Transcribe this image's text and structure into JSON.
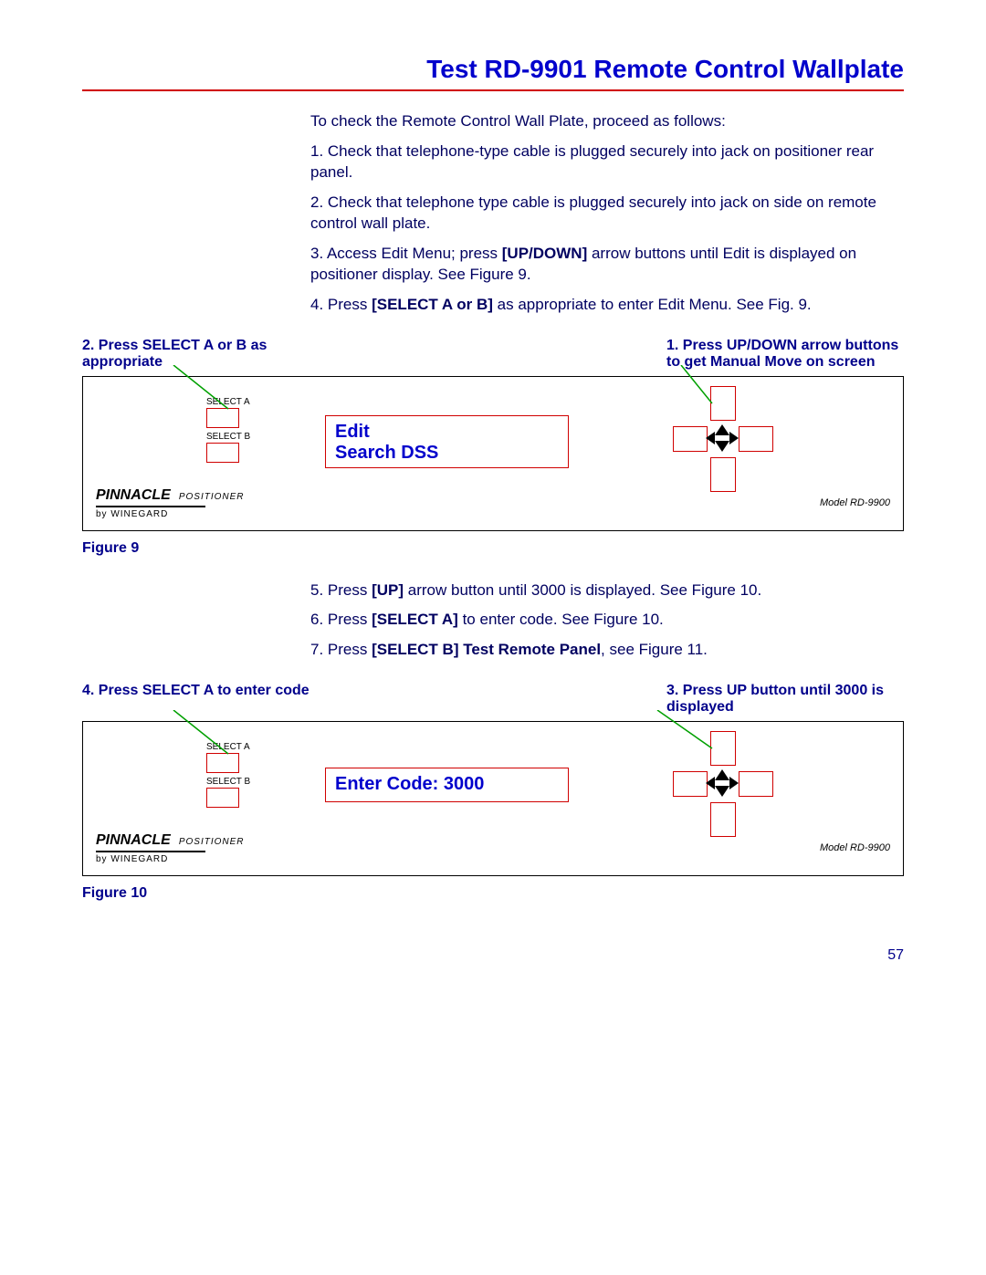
{
  "title": "Test RD-9901 Remote Control Wallplate",
  "intro": "To check the Remote Control Wall Plate, proceed as follows:",
  "steps": {
    "s1": "1.   Check that telephone-type cable is plugged securely into jack on positioner rear panel.",
    "s2": "2.   Check that telephone type cable is plugged securely into jack on side on remote control wall plate.",
    "s3a": "3.   Access Edit Menu; press ",
    "s3b": "[UP/DOWN]",
    "s3c": " arrow buttons until Edit is displayed on positioner display.  See Figure 9.",
    "s4a": "4.   Press ",
    "s4b": "[SELECT A or B]",
    "s4c": " as appropriate to enter Edit Menu.  See Fig. 9.",
    "s5a": "5.   Press ",
    "s5b": "[UP]",
    "s5c": " arrow button until 3000 is displayed. See Figure 10.",
    "s6a": "6.   Press ",
    "s6b": "[SELECT A]",
    "s6c": " to enter code.  See Figure 10.",
    "s7a": "7.   Press ",
    "s7b": "[SELECT B] Test Remote Panel",
    "s7c": ", see Figure 11."
  },
  "callouts": {
    "fig9_left": "2. Press SELECT A or B as appropriate",
    "fig9_right": "1.  Press  UP/DOWN  arrow buttons to get Manual Move on screen",
    "fig10_left": "4. Press SELECT A to enter code",
    "fig10_right": "3.   Press  UP  button  until 3000 is displayed"
  },
  "panel": {
    "select_a": "SELECT A",
    "select_b": "SELECT B",
    "brand": "PINNACLE",
    "brand_sub": "POSITIONER",
    "brand_by": "by WINEGARD",
    "model": "Model RD-9900",
    "screen9_line1": "Edit",
    "screen9_line2": "Search    DSS",
    "screen10": "Enter Code:  3000"
  },
  "figure9": "Figure 9",
  "figure10": "Figure 10",
  "page_number": "57"
}
